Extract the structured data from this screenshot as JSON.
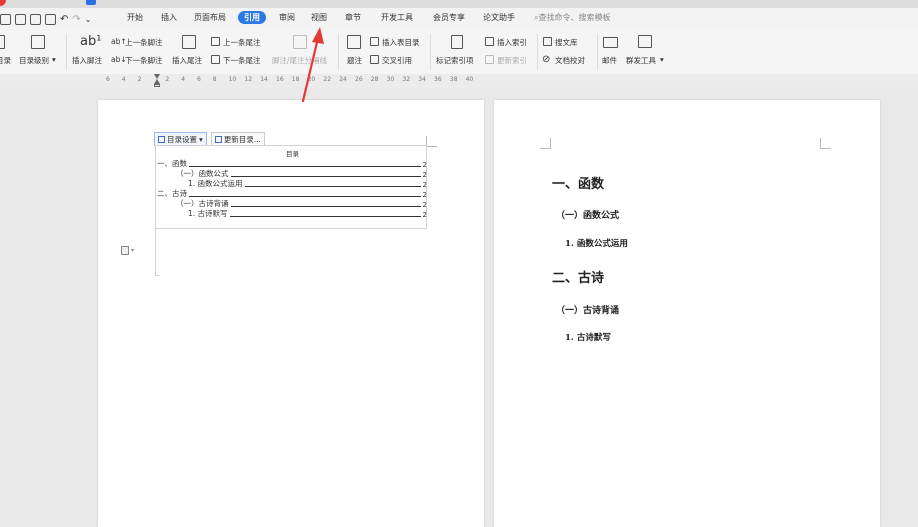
{
  "menu": {
    "items": [
      "开始",
      "插入",
      "页面布局",
      "引用",
      "审阅",
      "视图",
      "章节",
      "开发工具",
      "会员专享",
      "论文助手"
    ],
    "active": "引用",
    "search_placeholder": "查找命令、搜索模板"
  },
  "ribbon": {
    "toc": "目录",
    "toc_level": "目录级别",
    "insert_footnote": "插入脚注",
    "insert_endnote": "插入尾注",
    "prev_footnote": "上一条脚注",
    "next_footnote": "下一条脚注",
    "prev_endnote": "上一条尾注",
    "next_endnote": "下一条尾注",
    "footnote_separator": "脚注/尾注分隔线",
    "caption": "题注",
    "insert_table_of_figures": "插入表目录",
    "cross_reference": "交叉引用",
    "mark_index_entry": "标记索引项",
    "insert_index": "插入索引",
    "update_index": "更新索引",
    "doc_library": "搜文库",
    "doc_check": "文档校对",
    "mail": "邮件",
    "bulk_tools": "群发工具"
  },
  "ruler": {
    "ticks": [
      "6",
      "4",
      "2",
      "2",
      "4",
      "6",
      "8",
      "10",
      "12",
      "14",
      "16",
      "18",
      "20",
      "22",
      "24",
      "26",
      "28",
      "30",
      "32",
      "34",
      "36",
      "38",
      "40"
    ]
  },
  "toc_toolbar": {
    "settings": "目录设置",
    "update": "更新目录..."
  },
  "toc": {
    "title": "目录",
    "entries": [
      {
        "text": "一、函数",
        "page": "2"
      },
      {
        "text": "（一）函数公式",
        "page": "2"
      },
      {
        "text": "1. 函数公式运用",
        "page": "2"
      },
      {
        "text": "二、古诗",
        "page": "2"
      },
      {
        "text": "（一）古诗背诵",
        "page": "2"
      },
      {
        "text": "1. 古诗默写",
        "page": "2"
      }
    ]
  },
  "page2": {
    "h1_a": "一、函数",
    "h2_a": "（一）函数公式",
    "h3_a": "1. 函数公式运用",
    "h1_b": "二、古诗",
    "h2_b": "（一）古诗背诵",
    "h3_b": "1. 古诗默写"
  },
  "colors": {
    "active_tab": "#2b79e4",
    "annotation_arrow": "#e53935"
  }
}
